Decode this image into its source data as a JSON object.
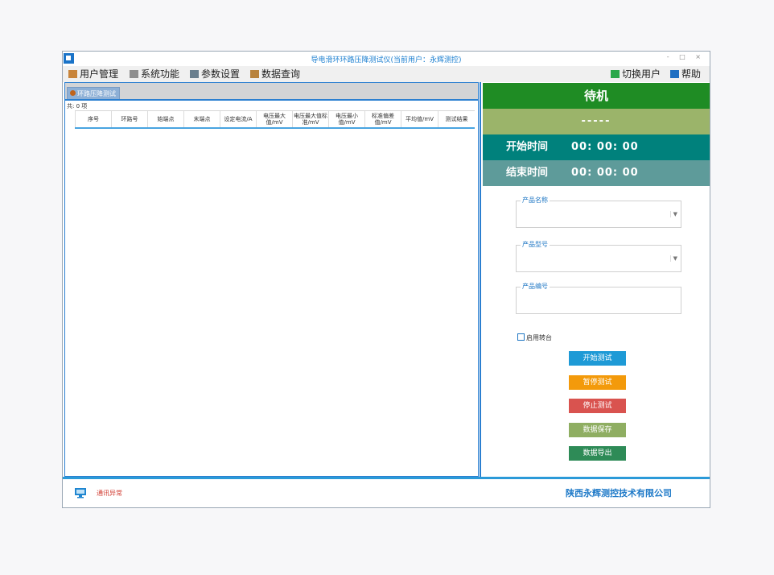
{
  "window": {
    "title": "导电滑环环路压降测试仪(当前用户：永辉测控)",
    "controls": "- □ ×"
  },
  "menu": {
    "user_mgmt": "用户管理",
    "system_func": "系统功能",
    "param_settings": "参数设置",
    "data_query": "数据查询",
    "switch_user": "切换用户",
    "help": "帮助"
  },
  "tab": {
    "label": "环路压降测试"
  },
  "grid": {
    "count": "共: 0 项",
    "columns": [
      "序号",
      "环路号",
      "始端点",
      "末端点",
      "设定电流/A",
      "电压最大值/mV",
      "电压最大值标准/mV",
      "电压最小值/mV",
      "标准偏差值/mV",
      "平均值/mV",
      "测试结果"
    ]
  },
  "status_panel": {
    "state": "待机",
    "dashes": "-----",
    "start_label": "开始时间",
    "start_value": "00: 00: 00",
    "end_label": "结束时间",
    "end_value": "00: 00: 00"
  },
  "form": {
    "product_name_label": "产品名称",
    "product_model_label": "产品型号",
    "product_serial_label": "产品编号",
    "enable_turntable_label": "启用转台"
  },
  "buttons": {
    "start": "开始测试",
    "pause": "暂停测试",
    "stop": "停止测试",
    "save": "数据保存",
    "export": "数据导出"
  },
  "colors": {
    "start": "#1e9ad6",
    "pause": "#f39a0b",
    "stop": "#d9534f",
    "save": "#8fae62",
    "export": "#2e8b57"
  },
  "statusbar": {
    "comm_status": "通讯异常",
    "company": "陕西永辉测控技术有限公司"
  }
}
